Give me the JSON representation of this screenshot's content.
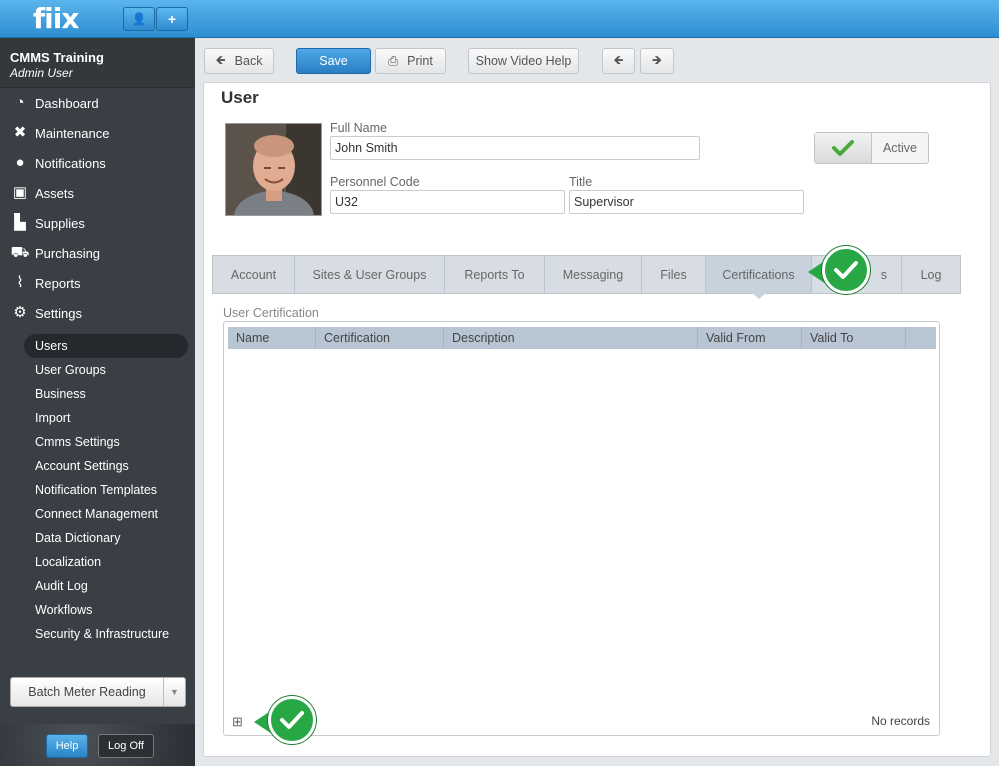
{
  "app": {
    "logo_text": "fiix",
    "brand_color": "#2f8fd2",
    "top_buttons": [
      {
        "icon": "user-icon",
        "glyph": "👤"
      },
      {
        "icon": "plus-icon",
        "glyph": "+"
      }
    ]
  },
  "account": {
    "org": "CMMS Training",
    "role": "Admin User"
  },
  "sidebar": {
    "items": [
      {
        "label": "Dashboard",
        "icon": "dashboard-icon",
        "glyph": "◔"
      },
      {
        "label": "Maintenance",
        "icon": "wrench-icon",
        "glyph": "✖"
      },
      {
        "label": "Notifications",
        "icon": "speech-bubble-icon",
        "glyph": "●"
      },
      {
        "label": "Assets",
        "icon": "box-icon",
        "glyph": "▣"
      },
      {
        "label": "Supplies",
        "icon": "forklift-icon",
        "glyph": "▙"
      },
      {
        "label": "Purchasing",
        "icon": "cart-icon",
        "glyph": "⛟"
      },
      {
        "label": "Reports",
        "icon": "chart-icon",
        "glyph": "⌇"
      },
      {
        "label": "Settings",
        "icon": "gear-icon",
        "glyph": "⚙"
      }
    ],
    "settings_items": [
      "Users",
      "User Groups",
      "Business",
      "Import",
      "Cmms Settings",
      "Account Settings",
      "Notification Templates",
      "Connect Management",
      "Data Dictionary",
      "Localization",
      "Audit Log",
      "Workflows",
      "Security & Infrastructure"
    ],
    "active_settings_item": "Users",
    "batch_button": "Batch Meter Reading",
    "help": "Help",
    "log_off": "Log Off"
  },
  "toolbar": {
    "back": "Back",
    "save": "Save",
    "print": "Print",
    "video_help": "Show Video Help"
  },
  "user": {
    "page_title": "User",
    "full_name_label": "Full Name",
    "full_name": "John Smith",
    "personnel_code_label": "Personnel Code",
    "personnel_code": "U32",
    "title_label": "Title",
    "title": "Supervisor",
    "status": "Active"
  },
  "tabs": [
    "Account",
    "Sites & User Groups",
    "Reports To",
    "Messaging",
    "Files",
    "Certifications",
    "s",
    "Log"
  ],
  "active_tab": "Certifications",
  "certification": {
    "section_label": "User Certification",
    "columns": [
      "Name",
      "Certification",
      "Description",
      "Valid From",
      "Valid To"
    ],
    "empty_text": "No records"
  },
  "colors": {
    "callout_green": "#27a844",
    "sidebar_bg": "#3a3f45",
    "grid_header": "#b8c5d2"
  }
}
